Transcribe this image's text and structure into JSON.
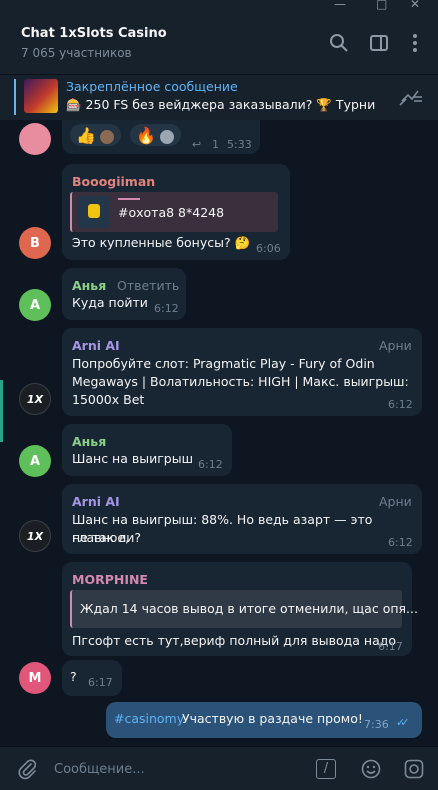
{
  "window": {
    "minimize": "—",
    "maximize": "□",
    "close": "✕"
  },
  "header": {
    "title": "Chat 1xSlots Casino",
    "subtitle": "7 065 участников"
  },
  "pinned": {
    "title": "Закреплённое сообщение",
    "text": "🎰 250 FS без вейджера заказывали? 🏆 Турни..."
  },
  "messages": [
    {
      "reactions": [
        "👍",
        "🔥"
      ],
      "reply_count": "1",
      "time": "5:33"
    },
    {
      "avatar": "B",
      "sender": "Booogiiman",
      "quote_text": "#охота8 8*4248",
      "text": "Это купленные бонусы? 🤔",
      "time": "6:06"
    },
    {
      "avatar": "A",
      "sender": "Анья",
      "reply_label": "Ответить",
      "text": "Куда пойти",
      "time": "6:12"
    },
    {
      "avatar": "1X",
      "sender": "Arni AI",
      "role": "Арни",
      "lines": [
        "Попробуйте слот: Pragmatic Play - Fury of Odin",
        "Megaways | Волатильность: HIGH | Макс. выигрыш:",
        "15000x Bet"
      ],
      "time": "6:12"
    },
    {
      "avatar": "A",
      "sender": "Анья",
      "text": "Шанс на выигрыш",
      "time": "6:12"
    },
    {
      "avatar": "1X",
      "sender": "Arni AI",
      "role": "Арни",
      "lines": [
        "Шанс на выигрыш: 88%. Но ведь азарт — это главное,",
        "не так ли?"
      ],
      "time": "6:12"
    },
    {
      "avatar": "M",
      "sender": "MORPHINE",
      "quote_text": "Ждал 14 часов вывод в итоге отменили, щас опя...",
      "text": "Пгсофт есть тут,вериф полный для вывода надо",
      "time": "6:17"
    },
    {
      "avatar": "M",
      "text": "?",
      "time": "6:17"
    },
    {
      "hashtag": "#casinomy",
      "text": "Участвую в раздаче промо!",
      "time": "7:36",
      "status": "✓✓"
    }
  ],
  "composer": {
    "placeholder": "Сообщение...",
    "command_label": "/"
  },
  "colors": {
    "accent": "#5eb5f7",
    "booogiiman": "#e0847d",
    "anya": "#8bd089",
    "arni": "#a695e7",
    "morphine": "#d28ab1"
  }
}
